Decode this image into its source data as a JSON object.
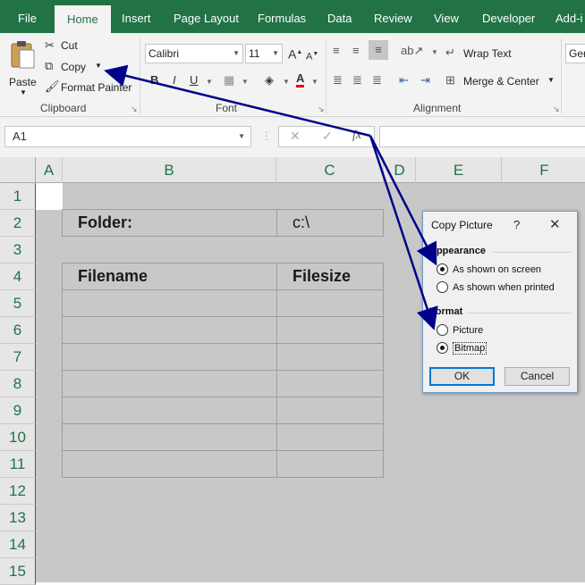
{
  "tabs": [
    "File",
    "Home",
    "Insert",
    "Page Layout",
    "Formulas",
    "Data",
    "Review",
    "View",
    "Developer",
    "Add-i"
  ],
  "clipboard": {
    "paste": "Paste",
    "cut": "Cut",
    "copy": "Copy",
    "format_painter": "Format Painter",
    "group": "Clipboard"
  },
  "font": {
    "name": "Calibri",
    "size": "11",
    "bold": "B",
    "italic": "I",
    "underline": "U",
    "color_letter": "A",
    "group": "Font"
  },
  "alignment": {
    "wrap_text": "Wrap Text",
    "merge_center": "Merge & Center",
    "group": "Alignment"
  },
  "number": {
    "format": "Ger"
  },
  "formula_bar": {
    "name_box": "A1",
    "fx": "fx",
    "cancel": "✕",
    "enter": "✓"
  },
  "columns": [
    "A",
    "B",
    "C",
    "D",
    "E",
    "F"
  ],
  "rows": [
    "1",
    "2",
    "3",
    "4",
    "5",
    "6",
    "7",
    "8",
    "9",
    "10",
    "11",
    "12",
    "13",
    "14",
    "15"
  ],
  "sheet": {
    "folder_label": "Folder:",
    "folder_value": "c:\\",
    "filename_header": "Filename",
    "filesize_header": "Filesize"
  },
  "dialog": {
    "title": "Copy Picture",
    "help": "?",
    "close": "✕",
    "appearance_label": "Appearance",
    "as_shown_on_screen": "As shown on screen",
    "as_shown_when_printed": "As shown when printed",
    "format_label": "Format",
    "picture": "Picture",
    "bitmap": "Bitmap",
    "ok": "OK",
    "cancel": "Cancel"
  },
  "colors": {
    "accent": "#217346",
    "arrow": "#00008b",
    "grid_bg": "#c8c8c8"
  }
}
